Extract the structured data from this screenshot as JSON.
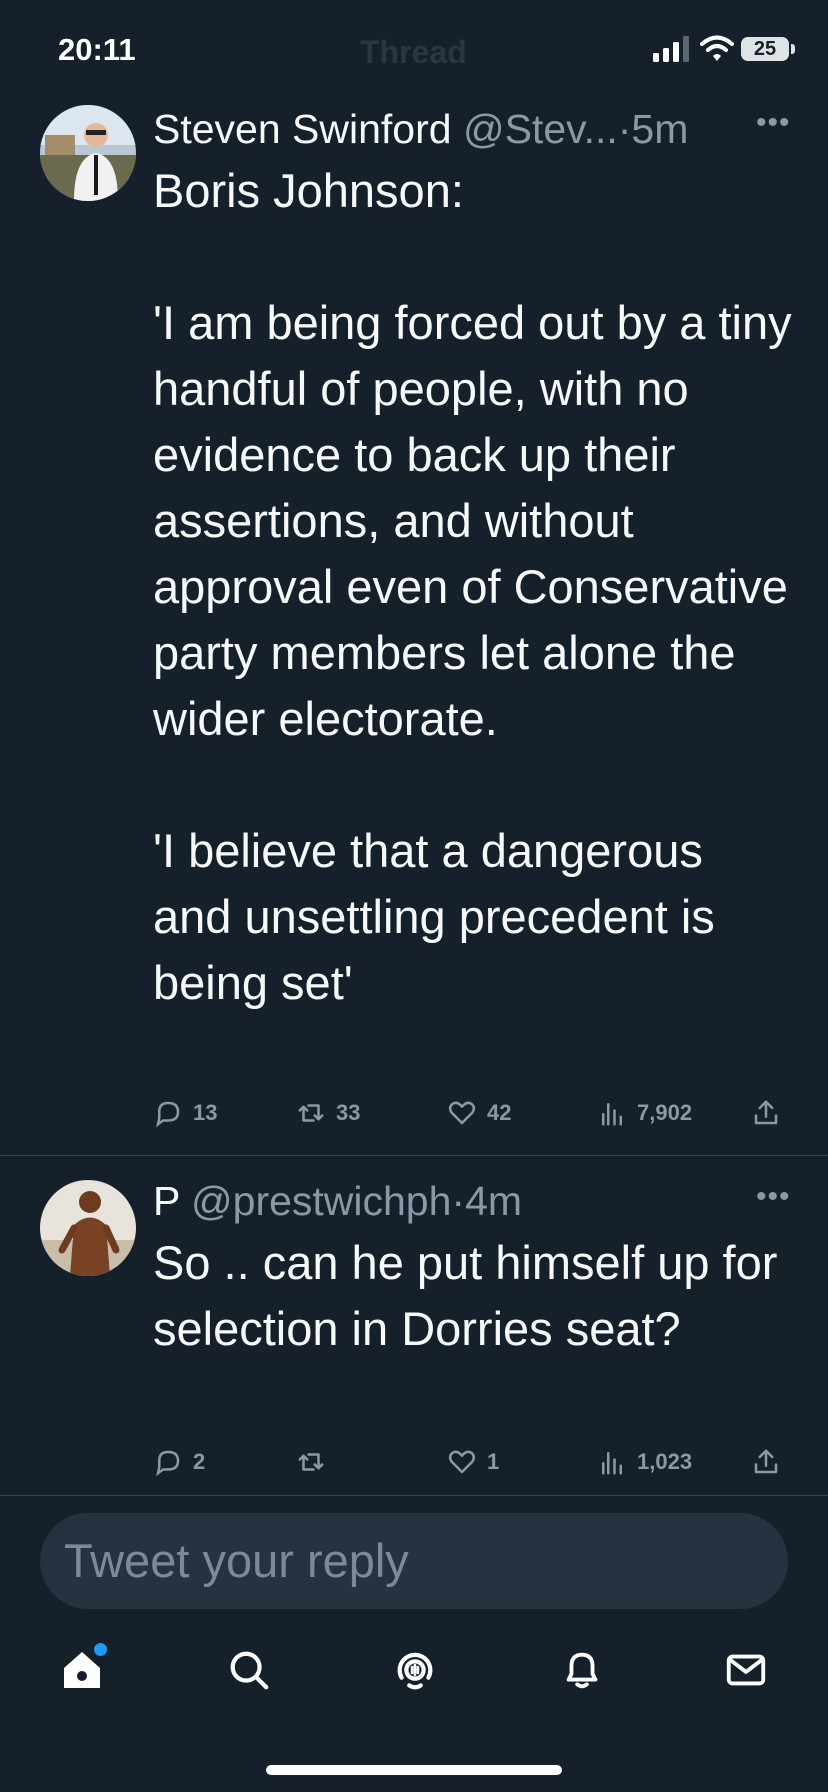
{
  "status": {
    "time": "20:11",
    "battery": "25",
    "ghost_title": "Thread"
  },
  "tweets": [
    {
      "name": "Steven Swinford",
      "handle": "@Stev...",
      "time": "5m",
      "body": "Boris Johnson:\n\n'I am being forced out by a tiny handful of people, with no evidence to back up their assertions, and without approval even of Conservative party members let alone the wider electorate.\n\n'I believe that a dangerous and unsettling precedent is being set'",
      "replies": "13",
      "retweets": "33",
      "likes": "42",
      "views": "7,902"
    },
    {
      "name": "P",
      "handle": "@prestwichph",
      "time": "4m",
      "body": "So .. can he put himself up for selection in Dorries seat?",
      "replies": "2",
      "retweets": "",
      "likes": "1",
      "views": "1,023"
    }
  ],
  "reply_box": {
    "placeholder": "Tweet your reply"
  },
  "colors": {
    "background": "#15202b",
    "accent": "#1d9bf0",
    "muted": "#8b98a5"
  },
  "tabs": [
    "home-icon",
    "search-icon",
    "spaces-icon",
    "notifications-icon",
    "messages-icon"
  ]
}
